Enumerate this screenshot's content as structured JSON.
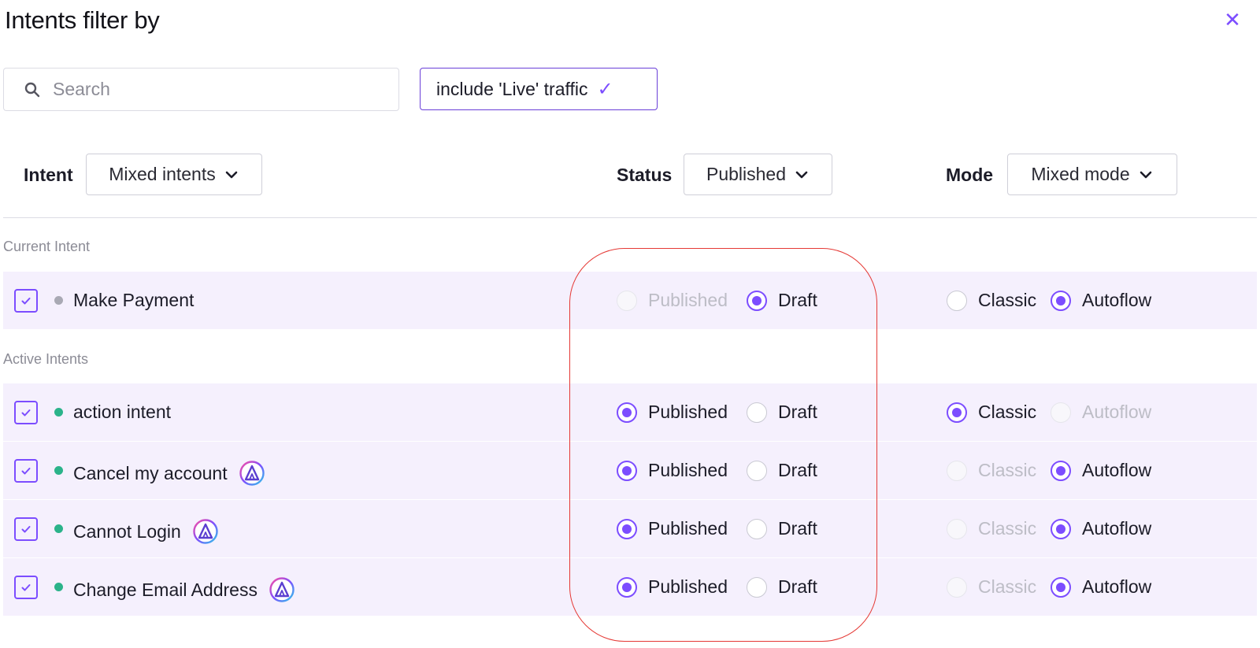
{
  "header": {
    "title": "Intents filter by",
    "close_icon": "close-icon"
  },
  "search": {
    "placeholder": "Search",
    "value": ""
  },
  "live_toggle": {
    "label": "include 'Live' traffic",
    "checked": true
  },
  "filters": {
    "intent": {
      "label": "Intent",
      "selected": "Mixed intents"
    },
    "status": {
      "label": "Status",
      "selected": "Published"
    },
    "mode": {
      "label": "Mode",
      "selected": "Mixed mode"
    }
  },
  "sections": {
    "current": "Current Intent",
    "active": "Active Intents"
  },
  "option_labels": {
    "published": "Published",
    "draft": "Draft",
    "classic": "Classic",
    "autoflow": "Autoflow"
  },
  "colors": {
    "accent": "#7c4dff",
    "row_bg": "#f5f0fd",
    "live_dot": "#2bb38a",
    "inactive_dot": "#a9a9b4",
    "annotation": "#e53935"
  },
  "current_intents": [
    {
      "name": "Make Payment",
      "checked": true,
      "dot": "inactive",
      "autoflow_badge": false,
      "status": "draft",
      "status_disabled": "published",
      "mode": "autoflow",
      "mode_disabled": null
    }
  ],
  "active_intents": [
    {
      "name": "action intent",
      "checked": true,
      "dot": "live",
      "autoflow_badge": false,
      "status": "published",
      "status_disabled": null,
      "mode": "classic",
      "mode_disabled": "autoflow"
    },
    {
      "name": "Cancel my account",
      "checked": true,
      "dot": "live",
      "autoflow_badge": true,
      "status": "published",
      "status_disabled": null,
      "mode": "autoflow",
      "mode_disabled": "classic"
    },
    {
      "name": "Cannot Login",
      "checked": true,
      "dot": "live",
      "autoflow_badge": true,
      "status": "published",
      "status_disabled": null,
      "mode": "autoflow",
      "mode_disabled": "classic"
    },
    {
      "name": "Change Email Address",
      "checked": true,
      "dot": "live",
      "autoflow_badge": true,
      "status": "published",
      "status_disabled": null,
      "mode": "autoflow",
      "mode_disabled": "classic"
    }
  ]
}
